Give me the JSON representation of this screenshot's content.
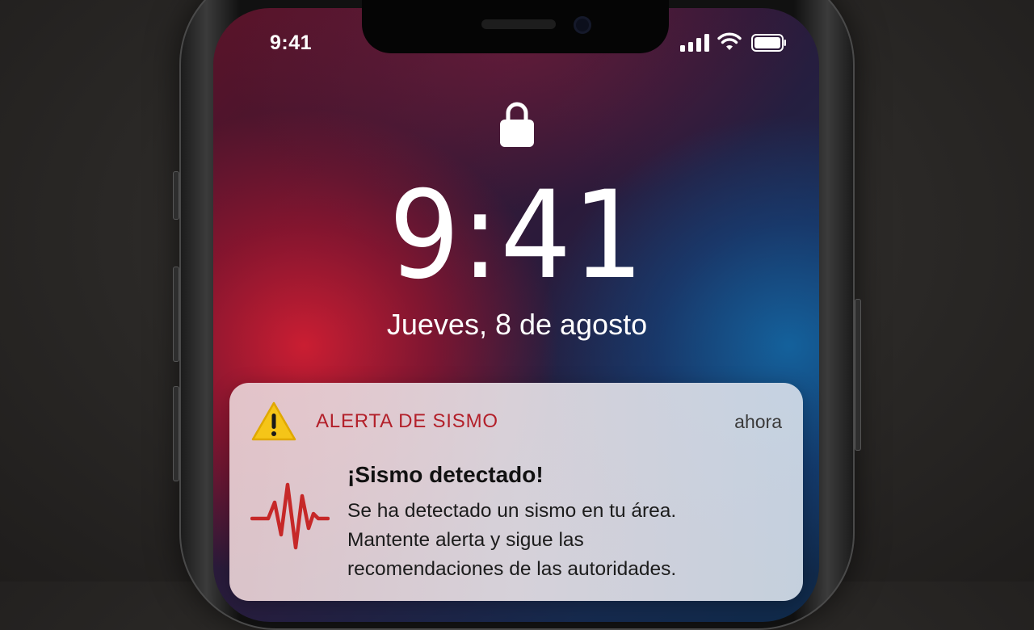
{
  "status_bar": {
    "time": "9:41",
    "signal_icon": "cellular-signal-icon",
    "wifi_icon": "wifi-icon",
    "battery_icon": "battery-icon"
  },
  "lock_screen": {
    "lock_icon": "lock-icon",
    "time": "9:41",
    "date": "Jueves, 8 de agosto"
  },
  "notification": {
    "app_icon": "warning-triangle-icon",
    "app_name": "ALERTA DE SISMO",
    "timestamp": "ahora",
    "content_icon": "seismic-wave-icon",
    "title": "¡Sismo detectado!",
    "body_lines": [
      "Se ha detectado un sismo en tu área.",
      "Mantente alerta y sigue las",
      "recomendaciones de las autoridades."
    ]
  },
  "colors": {
    "alert_red": "#b3202a",
    "warning_yellow": "#f5c518",
    "wave_red": "#c62828"
  }
}
